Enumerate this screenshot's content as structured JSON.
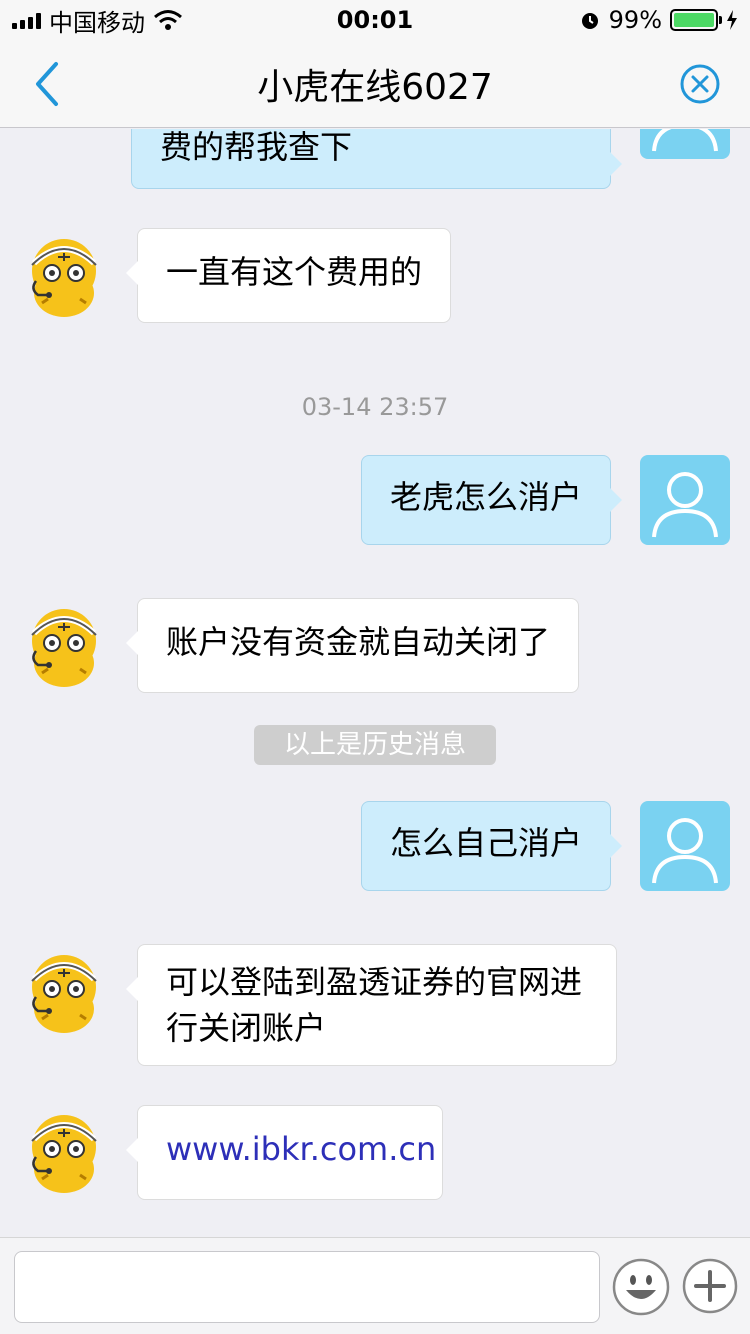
{
  "status_bar": {
    "carrier": "中国移动",
    "time": "00:01",
    "battery_percent": "99%",
    "battery_level": 0.99
  },
  "nav": {
    "title": "小虎在线6027",
    "back_icon": "chevron-left-icon",
    "close_icon": "close-circle-icon"
  },
  "messages": [
    {
      "from": "me",
      "text": "费的帮我查下"
    },
    {
      "from": "agent",
      "text": "一直有这个费用的"
    },
    {
      "type": "time",
      "text": "03-14 23:57"
    },
    {
      "from": "me",
      "text": "老虎怎么消户"
    },
    {
      "from": "agent",
      "text": "账户没有资金就自动关闭了"
    },
    {
      "type": "system",
      "text": "以上是历史消息"
    },
    {
      "from": "me",
      "text": "怎么自己消户"
    },
    {
      "from": "agent",
      "text_line1": "可以登陆到盈透证券的官网进",
      "text_line2": "行关闭账户"
    },
    {
      "from": "agent",
      "text": "www.ibkr.com.cn",
      "link": true
    }
  ],
  "input": {
    "value": "",
    "emoji_icon": "smiley-icon",
    "plus_icon": "plus-icon"
  },
  "colors": {
    "my_bubble": "#cdedfc",
    "agent_bubble": "#ffffff",
    "my_avatar": "#7ad2f1",
    "accent": "#2196d9",
    "link": "#2d2fb8"
  }
}
